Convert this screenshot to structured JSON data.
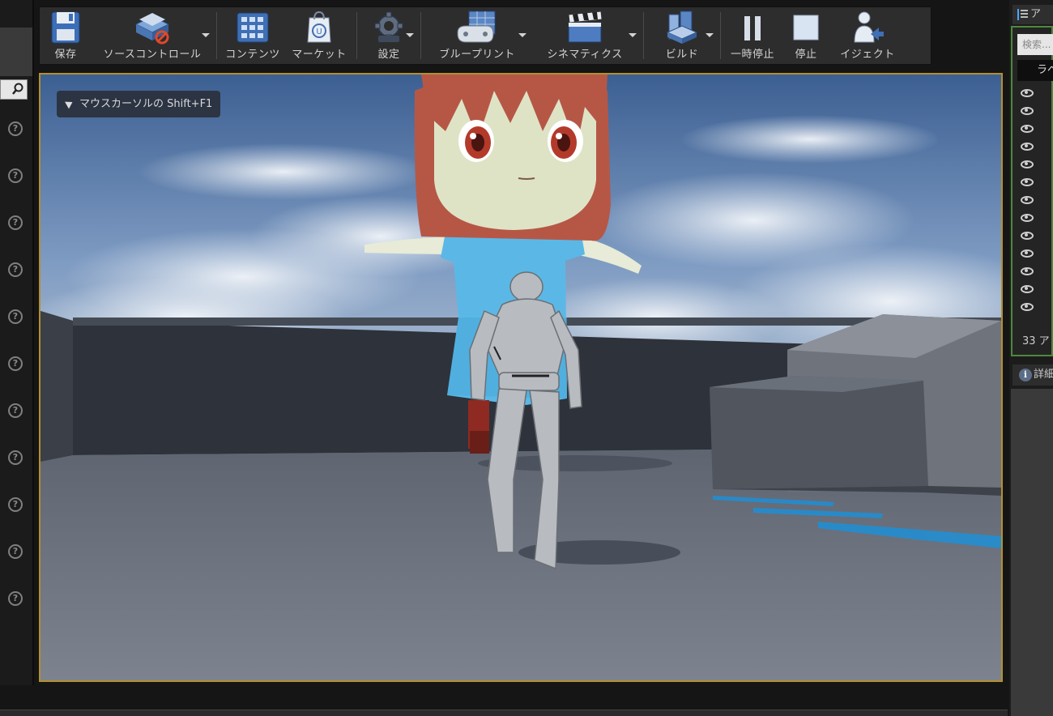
{
  "toolbar": {
    "buttons": [
      {
        "id": "save",
        "label": "保存",
        "icon": "save-icon"
      },
      {
        "id": "source-control",
        "label": "ソースコントロール",
        "icon": "source-control-icon"
      },
      {
        "id": "content",
        "label": "コンテンツ",
        "icon": "content-browser-icon"
      },
      {
        "id": "marketplace",
        "label": "マーケット",
        "icon": "marketplace-icon"
      },
      {
        "id": "settings",
        "label": "設定",
        "icon": "settings-gear-icon"
      },
      {
        "id": "blueprints",
        "label": "ブループリント",
        "icon": "blueprint-icon"
      },
      {
        "id": "cinematics",
        "label": "シネマティクス",
        "icon": "clapperboard-icon"
      },
      {
        "id": "build",
        "label": "ビルド",
        "icon": "build-icon"
      },
      {
        "id": "pause",
        "label": "一時停止",
        "icon": "pause-icon"
      },
      {
        "id": "stop",
        "label": "停止",
        "icon": "stop-icon"
      },
      {
        "id": "eject",
        "label": "イジェクト",
        "icon": "eject-icon"
      }
    ]
  },
  "viewport": {
    "hint_text": "マウスカーソルの Shift+F1"
  },
  "outliner": {
    "tab_label": "ア",
    "search_placeholder": "検索...",
    "header_label": "ラベル",
    "count_text": "33 ア"
  },
  "details": {
    "tab_label": "詳細"
  },
  "colors": {
    "viewport_border": "#b38f2e",
    "outliner_border": "#4c8a3c",
    "toolbar_bg": "#2d2d2d"
  }
}
